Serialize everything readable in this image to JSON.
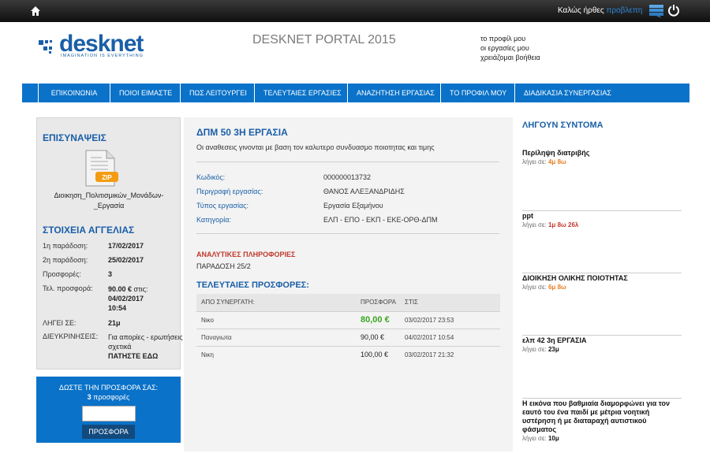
{
  "topbar": {
    "welcome": "Καλώς ήρθες",
    "user": "προβλεπη"
  },
  "header": {
    "logo_text": "desknet",
    "logo_tagline": "IMAGINATION IS EVERYTHING",
    "portal_title": "DESKNET PORTAL 2015",
    "links": [
      "το προφίλ μου",
      "οι εργασίες μου",
      "χρειάζομαι βοήθεια"
    ]
  },
  "nav": [
    "ΕΠΙΚΟΙΝΩΝΙΑ",
    "ΠΟΙΟΙ ΕΙΜΑΣΤΕ",
    "ΠΩΣ ΛΕΙΤΟΥΡΓΕΙ",
    "ΤΕΛΕΥΤΑΙΕΣ ΕΡΓΑΣΙΕΣ",
    "ΑΝΑΖΗΤΗΣΗ ΕΡΓΑΣΙΑΣ",
    "ΤΟ ΠΡΟΦΙΛ ΜΟΥ",
    "ΔΙΑΔΙΚΑΣΙΑ ΣΥΝΕΡΓΑΣΙΑΣ"
  ],
  "attachments": {
    "heading": "ΕΠΙΣΥΝΑΨΕΙΣ",
    "zip_label": "ZIP",
    "file_line1": "Διοικηση_Πολιτισμικών_Μονάδων-",
    "file_line2": "_Εργασία"
  },
  "ad": {
    "heading": "ΣΤΟΙΧΕΙΑ ΑΓΓΕΛΙΑΣ",
    "rows": [
      {
        "k": "1η παράδοση:",
        "v": "17/02/2017"
      },
      {
        "k": "2η παράδοση:",
        "v": "25/02/2017"
      },
      {
        "k": "Προσφορές:",
        "v": "3"
      },
      {
        "k": "Τελ. προσφορά:",
        "v_bold": "90.00 €",
        "v_rest": " στις:",
        "v2": "04/02/2017",
        "v3": "10:54"
      },
      {
        "k": "ΛΗΓΕΙ ΣΕ:",
        "v": "21μ"
      },
      {
        "k": "ΔΙΕΥΚΡΙΝΗΣΕΙΣ:",
        "v_normal": "Για απορίες - ερωτήσεις σχετικά",
        "v_bold": "ΠΑΤΗΣΤΕ ΕΔΩ"
      }
    ]
  },
  "offer_box": {
    "title": "ΔΩΣΤΕ ΤΗΝ ΠΡΟΣΦΟΡΑ ΣΑΣ:",
    "count": "3",
    "count_suffix": " προσφορές",
    "input_value": "",
    "button": "ΠΡΟΣΦΟΡΑ"
  },
  "job": {
    "title": "ΔΠΜ 50 3Η ΕΡΓΑΣΙΑ",
    "subtitle": "Οι αναθεσεις γινονται με βαση τον καλυτερο συνδυασμο ποιοτητας και τιμης",
    "details": [
      {
        "k": "Κωδικός:",
        "v": "000000013732"
      },
      {
        "k": "Περιγραφή εργασίας:",
        "v": "ΘΑΝΟΣ ΑΛΕΞΑΝΔΡΙΔΗΣ"
      },
      {
        "k": "Τύπος εργασίας:",
        "v": "Εργασία Εξαμήνου"
      },
      {
        "k": "Κατηγορία:",
        "v": "ΕΛΠ - ΕΠΟ - ΕΚΠ - ΕΚΕ-ΟΡΘ-ΔΠΜ"
      }
    ],
    "analytic_heading": "ΑΝΑΛΥΤΙΚΕΣ ΠΛΗΡΟΦΟΡΙΕΣ",
    "analytic_text": "ΠΑΡΑΔΟΣΗ 25/2",
    "offers_heading": "ΤΕΛΕΥΤΑΙΕΣ ΠΡΟΣΦΟΡΕΣ:",
    "offers_cols": [
      "ΑΠΟ ΣΥΝΕΡΓΑΤΗ:",
      "ΠΡΟΣΦΟΡΑ",
      "ΣΤΙΣ"
    ],
    "offers": [
      {
        "who": "Νικο",
        "price": "80,00 €",
        "when": "03/02/2017 23:53"
      },
      {
        "who": "Παναγιωτα",
        "price": "90,00 €",
        "when": "04/02/2017 10:54"
      },
      {
        "who": "Νικη",
        "price": "100,00 €",
        "when": "03/02/2017 21:32"
      }
    ]
  },
  "expiring": {
    "heading": "ΛΗΓΟΥΝ ΣΥΝΤΟΜΑ",
    "prefix": "λήγει σε:",
    "items": [
      {
        "title": "Περίληψη διατριβής",
        "a": "4μ",
        "b": "8ω",
        "c": ""
      },
      {
        "title": "ppt",
        "a": "1μ",
        "b": "8ω",
        "c": "26λ"
      },
      {
        "title": "ΔΙΟΙΚΗΣΗ ΟΛΙΚΗΣ ΠΟΙΟΤΗΤΑΣ",
        "a": "6μ",
        "b": "8ω",
        "c": ""
      },
      {
        "title": "ελπ 42 3η ΕΡΓΑΣΙΑ",
        "a": "23μ",
        "b": "",
        "c": ""
      },
      {
        "title": "Η εικόνα που βαθμιαία διαμορφώνει για τον εαυτό του ένα παιδί με μέτρια νοητική υστέρηση ή με διαταραχή αυτιστικού φάσματος",
        "a": "10μ",
        "b": "",
        "c": ""
      }
    ]
  }
}
